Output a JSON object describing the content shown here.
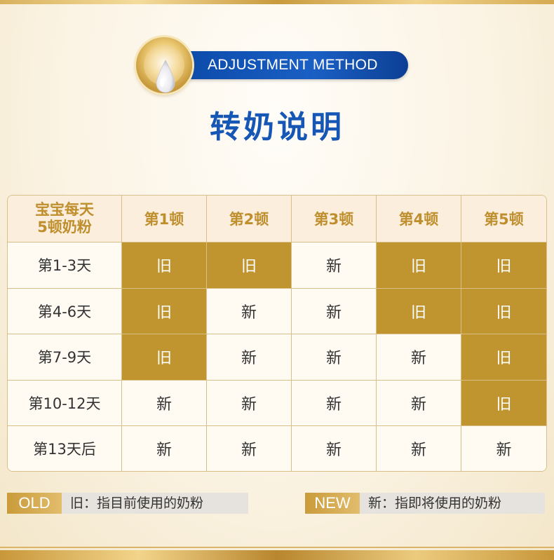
{
  "header": {
    "subtitle": "ADJUSTMENT METHOD",
    "title": "转奶说明"
  },
  "table": {
    "corner_line1": "宝宝每天",
    "corner_line2": "5顿奶粉",
    "columns": [
      "第1顿",
      "第2顿",
      "第3顿",
      "第4顿",
      "第5顿"
    ],
    "rows": [
      {
        "label": "第1-3天",
        "cells": [
          "旧",
          "旧",
          "新",
          "旧",
          "旧"
        ]
      },
      {
        "label": "第4-6天",
        "cells": [
          "旧",
          "新",
          "新",
          "旧",
          "旧"
        ]
      },
      {
        "label": "第7-9天",
        "cells": [
          "旧",
          "新",
          "新",
          "新",
          "旧"
        ]
      },
      {
        "label": "第10-12天",
        "cells": [
          "新",
          "新",
          "新",
          "新",
          "旧"
        ]
      },
      {
        "label": "第13天后",
        "cells": [
          "新",
          "新",
          "新",
          "新",
          "新"
        ]
      }
    ]
  },
  "legend": {
    "old_tag": "OLD",
    "old_desc": "旧：指目前使用的奶粉",
    "new_tag": "NEW",
    "new_desc": "新：指即将使用的奶粉"
  },
  "colors": {
    "old_cell": "#c0952f",
    "title_blue": "#1656b5",
    "header_gold": "#bf8e2d"
  }
}
